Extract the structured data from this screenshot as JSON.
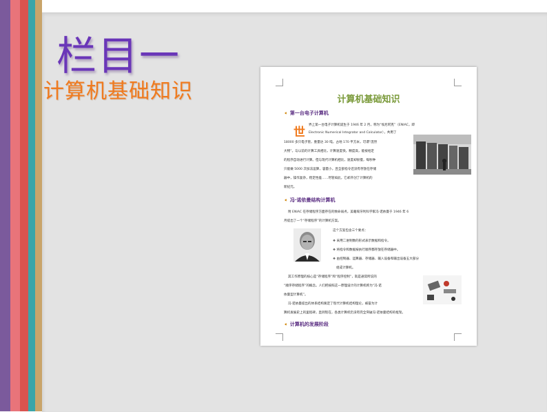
{
  "slide": {
    "column_title": "栏目一",
    "column_subtitle": "计算机基础知识"
  },
  "document": {
    "title": "计算机基础知识",
    "sections": [
      {
        "heading": "第一台电子计算机"
      },
      {
        "heading": "冯·诺依曼结构计算机"
      },
      {
        "heading": "计算机的发展阶段"
      }
    ],
    "dropcap": "世",
    "sec1_lines": [
      "界上第一台电子计算机诞生于 1946 年 2 月，称为“埃尼阿克”（ENIAC，即",
      "Electronic Numerical Integrator and Calculator），共用了",
      "18000 多只电子管，重量达 30 吨，占地 170 平方米，可谓“庞然",
      "大物”。与以前的计算工具相比，计算速度快，精度高，能按给定",
      "的程序自动进行计算。但与现代计算机相比，速度却很慢，每秒钟",
      "只能做 5000 次加法运算，容量小，且全部指令还没有存放在存储",
      "器中，操作复杂，稳定性差……尽管如此，它却开创了计算机的",
      "新纪元。"
    ],
    "sec2_intro": [
      "附 ENIAC 在存储程序方面存在的致命弱点，美籍匈牙利科学家冯·诺依曼于 1946 年 6",
      "月提出了一个“存储程序”的计算机方案。"
    ],
    "sec2_points_title": "这个方案包含三个要点：",
    "sec2_points": [
      "采用二进制数的形式表示数据和指令。",
      "将指令和数据按执行顺序都存放在存储器中。",
      "由控制器、运算器、存储器、输入设备和输出设备五大部分"
    ],
    "sec2_points_cont": "组成计算机。",
    "sec2_body": [
      "其工作原理的核心是“存储程序”和“程序控制”，就是通常所说的",
      "“顺序存储程序”的概念。人们把按照这一原理设计的计算机称为“冯·诺",
      "依曼型计算机”。",
      "冯·诺依曼提出的体系结构奠定了现代计算机结构理论，被誉为计",
      "算机发展史上的里程碑，直到现在，各类计算机仍没有完全突破冯·诺依曼结构的框架。"
    ]
  }
}
